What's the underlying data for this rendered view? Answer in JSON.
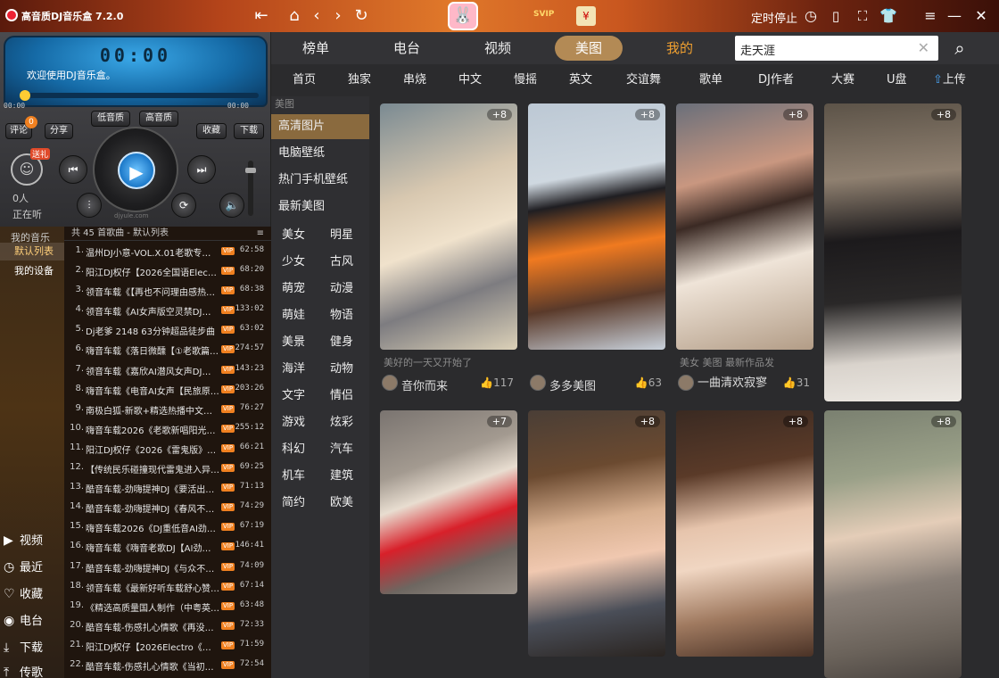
{
  "titlebar": {
    "app_title": "高音质DJ音乐盒 7.2.0",
    "svip": "SVIP",
    "timer_stop": "定时停止"
  },
  "player": {
    "time": "00:00",
    "welcome": "欢迎使用DJ音乐盒。",
    "time_left": "00:00",
    "time_right": "00:00",
    "comment_label": "评论",
    "comment_count": "0",
    "share_label": "分享",
    "low_quality": "低音质",
    "high_quality": "高音质",
    "collect_label": "收藏",
    "download_label": "下载",
    "gift_label": "送礼",
    "listeners": "0人",
    "listening": "正在听",
    "progress": 0,
    "watermark": "djyule.com"
  },
  "sidebar": {
    "head": "我的音乐",
    "items": [
      {
        "label": "默认列表",
        "active": true
      },
      {
        "label": "我的设备",
        "active": false
      }
    ],
    "bottom": [
      {
        "label": "视频",
        "icon": "video-icon"
      },
      {
        "label": "最近",
        "icon": "clock-icon"
      },
      {
        "label": "收藏",
        "icon": "heart-icon"
      },
      {
        "label": "电台",
        "icon": "radio-icon"
      },
      {
        "label": "下载",
        "icon": "download-icon"
      },
      {
        "label": "传歌",
        "icon": "upload-icon"
      }
    ]
  },
  "playlist": {
    "header": "共 45 首歌曲 - 默认列表",
    "rows": [
      {
        "num": "1.",
        "title": "温州DJ小意-VOL.X.01老歌专辑…",
        "dur": "62:58"
      },
      {
        "num": "2.",
        "title": "阳江DJ权仔【2026全国语Electro",
        "dur": "68:20"
      },
      {
        "num": "3.",
        "title": "领音车载《【再也不问理由感热…",
        "dur": "68:38"
      },
      {
        "num": "4.",
        "title": "领音车载《AI女声版空灵禁DJ【…",
        "dur": "133:02"
      },
      {
        "num": "5.",
        "title": "Dj老爹 2148 63分钟超品徒步曲",
        "dur": "63:02"
      },
      {
        "num": "6.",
        "title": "嗨音车载《落日微醺【①老歌篇…",
        "dur": "274:57"
      },
      {
        "num": "7.",
        "title": "领音车载《嘉欣AI潜风女声DJ新…",
        "dur": "143:23"
      },
      {
        "num": "8.",
        "title": "嗨音车载《电音AI女声【民旅原…",
        "dur": "203:26"
      },
      {
        "num": "9.",
        "title": "南极白狐-新歌+精选热播中文舞…",
        "dur": "76:27"
      },
      {
        "num": "10.",
        "title": "嗨音车载2026《老歌新唱阳光…",
        "dur": "255:12"
      },
      {
        "num": "11.",
        "title": "阳江DJ权仔《2026《雷鬼版》享…",
        "dur": "66:21"
      },
      {
        "num": "12.",
        "title": "【传统民乐碰撞现代雷鬼进入异…",
        "dur": "69:25"
      },
      {
        "num": "13.",
        "title": "酷音车载-劲嗨提神DJ《要活出…",
        "dur": "71:13"
      },
      {
        "num": "14.",
        "title": "酷音车载-劲嗨提神DJ《春风不…",
        "dur": "74:29"
      },
      {
        "num": "15.",
        "title": "嗨音车载2026《DJ重低音AI劲嗨…",
        "dur": "67:19"
      },
      {
        "num": "16.",
        "title": "嗨音车载《嗨音老歌DJ【AI劲…",
        "dur": "146:41"
      },
      {
        "num": "17.",
        "title": "酷音车载-劲嗨提神DJ《与众不…",
        "dur": "74:09"
      },
      {
        "num": "18.",
        "title": "领音车载《最新好听车载舒心赞…",
        "dur": "67:14"
      },
      {
        "num": "19.",
        "title": "《精选高质量国人制作（中粤英…",
        "dur": "63:48"
      },
      {
        "num": "20.",
        "title": "酷音车载-伤感扎心情歌《再没…",
        "dur": "72:33"
      },
      {
        "num": "21.",
        "title": "阳江DJ权仔【2026Electro《中…",
        "dur": "71:59"
      },
      {
        "num": "22.",
        "title": "酷音车载-伤感扎心情歌《当初…",
        "dur": "72:54"
      }
    ]
  },
  "tabs": [
    {
      "label": "榜单"
    },
    {
      "label": "电台"
    },
    {
      "label": "视频"
    },
    {
      "label": "美图"
    },
    {
      "label": "我的"
    }
  ],
  "search": {
    "value": "走天涯"
  },
  "subnav": [
    "首页",
    "独家",
    "串烧",
    "中文",
    "慢摇",
    "英文",
    "交谊舞",
    "歌单",
    "DJ作者",
    "大赛",
    "U盘",
    "上传"
  ],
  "categories": {
    "title": "美图",
    "items": [
      "高清图片",
      "电脑壁纸",
      "热门手机壁纸",
      "最新美图"
    ],
    "tags": [
      "美女",
      "明星",
      "少女",
      "古风",
      "萌宠",
      "动漫",
      "萌娃",
      "物语",
      "美景",
      "健身",
      "海洋",
      "动物",
      "文字",
      "情侣",
      "游戏",
      "炫彩",
      "科幻",
      "汽车",
      "机车",
      "建筑",
      "简约",
      "欧美"
    ]
  },
  "cards": [
    {
      "plus": "+8",
      "desc": "美好的一天又开始了",
      "author": "音你而来",
      "likes": "117"
    },
    {
      "plus": "+8",
      "desc": "",
      "author": "多多美图",
      "likes": "63"
    },
    {
      "plus": "+8",
      "desc": "美女 美图 最新作品发",
      "author": "一曲清欢寂寥",
      "likes": "31"
    },
    {
      "plus": "+8",
      "desc": "",
      "author": "",
      "likes": ""
    },
    {
      "plus": "+7",
      "desc": "",
      "author": "",
      "likes": ""
    },
    {
      "plus": "+8",
      "desc": "",
      "author": "",
      "likes": ""
    },
    {
      "plus": "+8",
      "desc": "",
      "author": "",
      "likes": ""
    },
    {
      "plus": "+8",
      "desc": "",
      "author": "",
      "likes": ""
    }
  ]
}
